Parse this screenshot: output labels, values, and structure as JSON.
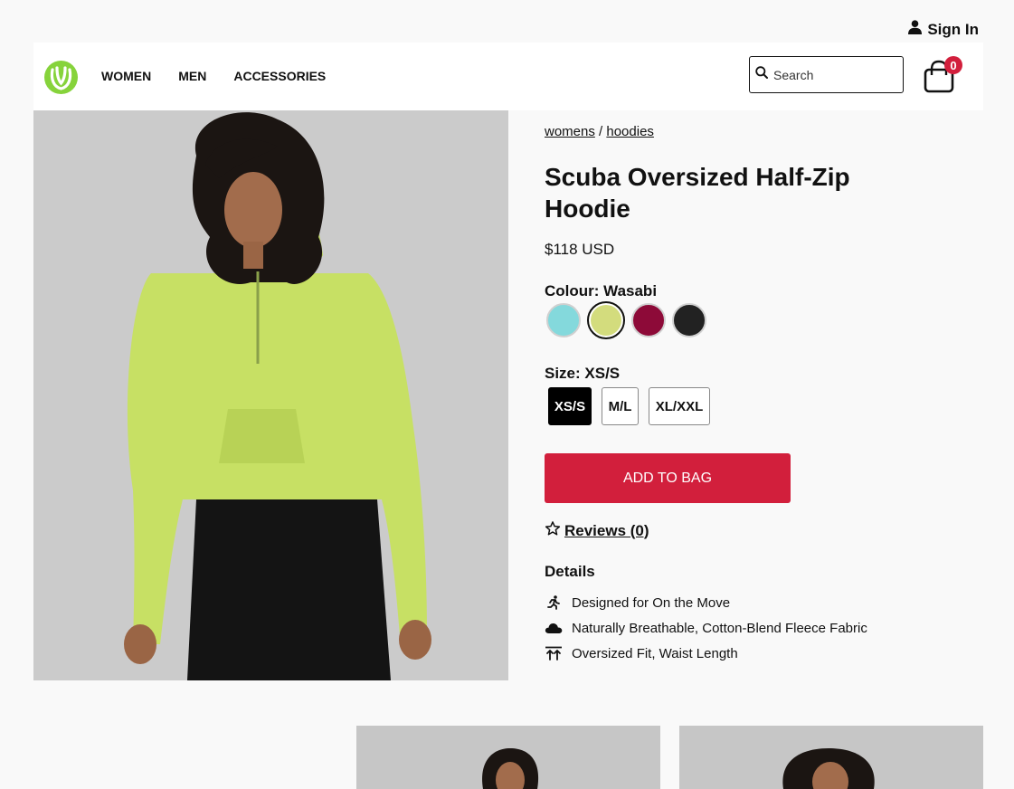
{
  "topbar": {
    "signin_label": "Sign In"
  },
  "header": {
    "nav": [
      "WOMEN",
      "MEN",
      "ACCESSORIES"
    ],
    "search_placeholder": "Search",
    "cart_count": "0"
  },
  "product": {
    "breadcrumb": [
      "womens",
      "hoodies"
    ],
    "breadcrumb_sep": "/",
    "title": "Scuba Oversized Half-Zip Hoodie",
    "price": "$118 USD",
    "colour_prefix": "Colour: ",
    "colour_selected": "Wasabi",
    "colours": [
      "#84d9dc",
      "#d3dc7d",
      "#8d0a38",
      "#222222"
    ],
    "colour_selected_index": 1,
    "size_prefix": "Size: ",
    "size_selected": "XS/S",
    "sizes": [
      "XS/S",
      "M/L",
      "XL/XXL"
    ],
    "add_to_bag": "ADD TO BAG",
    "reviews": "Reviews (0)",
    "details_heading": "Details",
    "details": [
      {
        "icon": "running-icon",
        "text": "Designed for On the Move"
      },
      {
        "icon": "cloud-icon",
        "text": "Naturally Breathable, Cotton-Blend Fleece Fabric"
      },
      {
        "icon": "length-icon",
        "text": "Oversized Fit, Waist Length"
      }
    ]
  },
  "colors": {
    "accent": "#d21f3c",
    "brand_green": "#86d33b"
  }
}
